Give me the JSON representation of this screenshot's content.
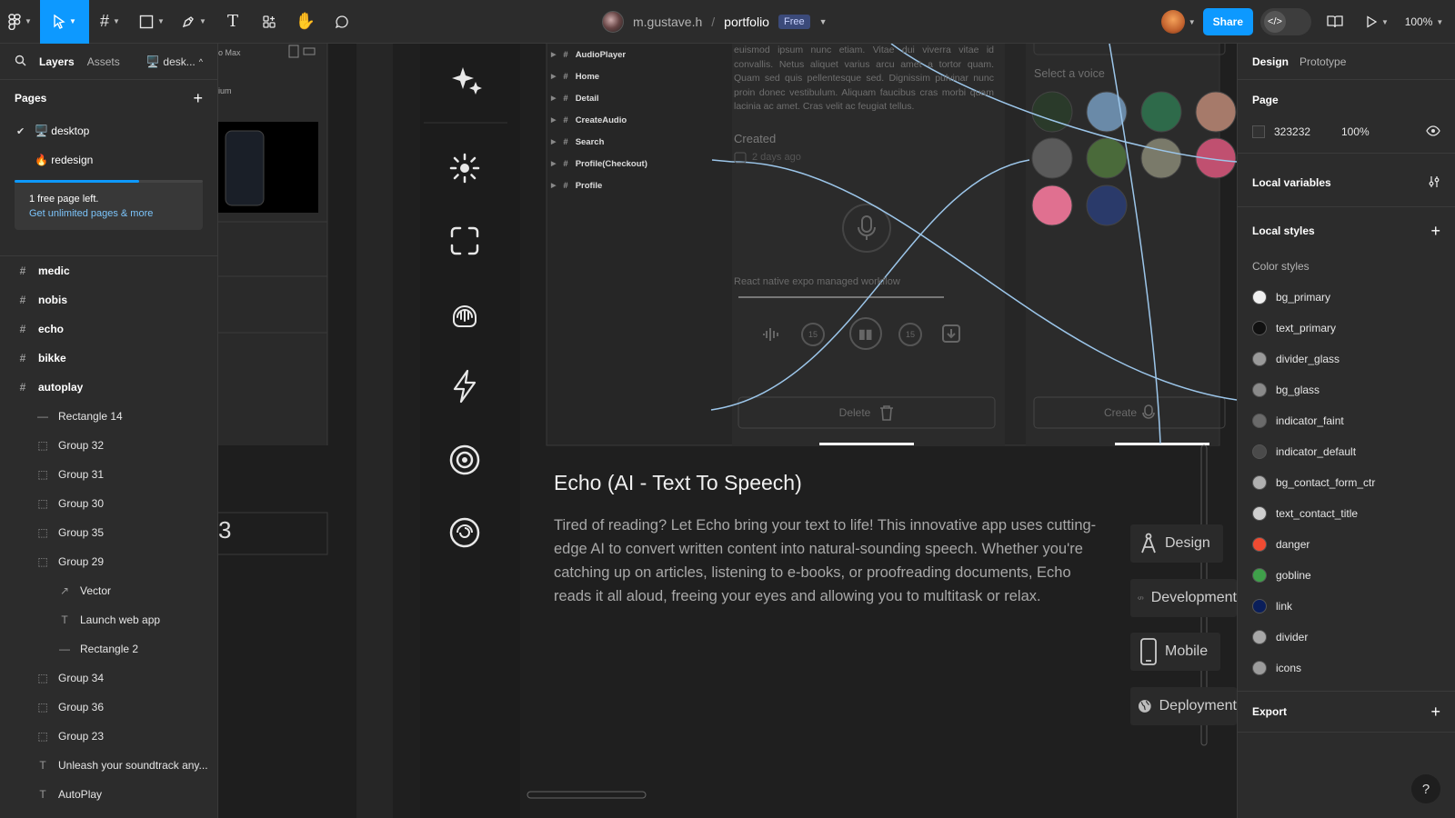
{
  "toolbar": {
    "zoom": "100%"
  },
  "file": {
    "user": "m.gustave.h",
    "separator": "/",
    "name": "portfolio",
    "plan_badge": "Free"
  },
  "share_label": "Share",
  "devmode_icon": "</>",
  "left_panel": {
    "tabs": [
      "Layers",
      "Assets"
    ],
    "page_switch": "desk...",
    "pages_title": "Pages",
    "pages": [
      {
        "label": "🖥️ desktop",
        "active": true
      },
      {
        "label": "🔥 redesign",
        "active": false
      }
    ],
    "upsell_progress": 0.66,
    "upsell_text": "1 free page left.",
    "upsell_link": "Get unlimited pages & more",
    "layers": [
      {
        "label": "medic",
        "type": "frame",
        "depth": 0
      },
      {
        "label": "nobis",
        "type": "frame",
        "depth": 0
      },
      {
        "label": "echo",
        "type": "frame",
        "depth": 0
      },
      {
        "label": "bikke",
        "type": "frame",
        "depth": 0
      },
      {
        "label": "autoplay",
        "type": "frame",
        "depth": 0
      },
      {
        "label": "Rectangle 14",
        "type": "line",
        "depth": 1
      },
      {
        "label": "Group 32",
        "type": "group",
        "depth": 1
      },
      {
        "label": "Group 31",
        "type": "group",
        "depth": 1
      },
      {
        "label": "Group 30",
        "type": "group",
        "depth": 1
      },
      {
        "label": "Group 35",
        "type": "group",
        "depth": 1
      },
      {
        "label": "Group 29",
        "type": "group",
        "depth": 1
      },
      {
        "label": "Vector",
        "type": "vector",
        "depth": 2
      },
      {
        "label": "Launch web app",
        "type": "text",
        "depth": 2
      },
      {
        "label": "Rectangle 2",
        "type": "line",
        "depth": 2
      },
      {
        "label": "Group 34",
        "type": "group",
        "depth": 1
      },
      {
        "label": "Group 36",
        "type": "group",
        "depth": 1
      },
      {
        "label": "Group 23",
        "type": "group",
        "depth": 1
      },
      {
        "label": "Unleash your soundtrack any...",
        "type": "text",
        "depth": 1
      },
      {
        "label": "AutoPlay",
        "type": "text",
        "depth": 1
      }
    ]
  },
  "canvas": {
    "partial_label_top": "o Max",
    "partial_label_2": "ium",
    "partial_digit": "3",
    "screens": [
      "AudioPlayer",
      "Home",
      "Detail",
      "CreateAudio",
      "Search",
      "Profile(Checkout)",
      "Profile"
    ],
    "lorem": "euismod ipsum nunc etiam. Vitae dui viverra vitae id convallis. Netus aliquet varius arcu amet a tortor quam. Quam sed quis pellentesque sed. Dignissim pulvinar nunc proin donec vestibulum. Aliquam faucibus cras morbi quam lacinia ac amet. Cras velit ac feugiat tellus.",
    "created_label": "Created",
    "created_value": "2 days ago",
    "workflow_text": "React native expo managed workflow",
    "skip_back": "15",
    "skip_fwd": "15",
    "delete_label": "Delete",
    "voice_label": "Select a voice",
    "create_label": "Create",
    "project_title": "Echo (AI - Text To Speech)",
    "project_desc": "Tired of reading?  Let Echo bring your text to life! This innovative app uses cutting-edge AI to convert written content into natural-sounding speech.  Whether you're catching up on articles, listening to e-books, or proofreading documents, Echo reads it all aloud, freeing your eyes and allowing you to multitask or relax.",
    "tags": [
      "Design",
      "Development",
      "Mobile",
      "Deployment"
    ],
    "voice_colors": [
      "#2a3a2a",
      "#6a8aa8",
      "#2e6a4a",
      "#a67a6a",
      "#5a5a5a",
      "#4a6a3a",
      "#7a7a6a",
      "#c05070",
      "#e07090",
      "#2a3a6a"
    ]
  },
  "right_panel": {
    "tabs": [
      "Design",
      "Prototype"
    ],
    "page_title": "Page",
    "page_color": "323232",
    "page_opacity": "100%",
    "local_variables": "Local variables",
    "local_styles": "Local styles",
    "color_styles_label": "Color styles",
    "colors": [
      {
        "name": "bg_primary",
        "color": "#f0f0f0"
      },
      {
        "name": "text_primary",
        "color": "#111111"
      },
      {
        "name": "divider_glass",
        "color": "#9a9a9a"
      },
      {
        "name": "bg_glass",
        "color": "#8a8a8a"
      },
      {
        "name": "indicator_faint",
        "color": "#6a6a6a"
      },
      {
        "name": "indicator_default",
        "color": "#4a4a4a"
      },
      {
        "name": "bg_contact_form_ctr",
        "color": "#b0b0b0"
      },
      {
        "name": "text_contact_title",
        "color": "#cfcfcf"
      },
      {
        "name": "danger",
        "color": "#ef4b32"
      },
      {
        "name": "gobline",
        "color": "#3fa04a"
      },
      {
        "name": "link",
        "color": "#0a1e5a"
      },
      {
        "name": "divider",
        "color": "#a8a8a8"
      },
      {
        "name": "icons",
        "color": "#9c9c9c"
      }
    ],
    "export_label": "Export",
    "help": "?"
  }
}
